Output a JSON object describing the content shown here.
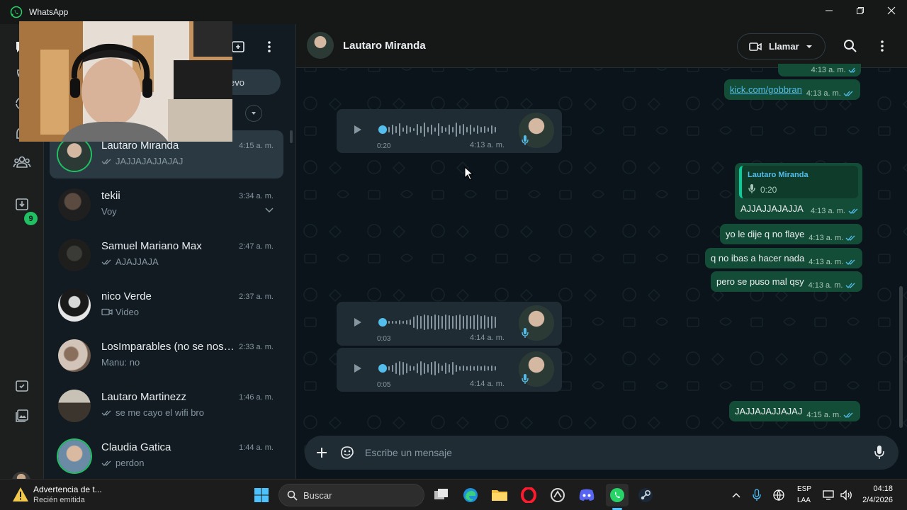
{
  "window": {
    "title": "WhatsApp"
  },
  "chat_list": {
    "new_button_fragment": "evo",
    "chats": [
      {
        "name": "Lautaro Miranda",
        "time": "4:15 a. m.",
        "preview": "JAJJAJAJJAJAJ",
        "ticks": true
      },
      {
        "name": "tekii",
        "time": "3:34 a. m.",
        "preview": "Voy",
        "ticks": false
      },
      {
        "name": "Samuel Mariano Max",
        "time": "2:47 a. m.",
        "preview": "AJAJJAJA",
        "ticks": true
      },
      {
        "name": "nico Verde",
        "time": "2:37 a. m.",
        "preview": "Video",
        "ticks": false
      },
      {
        "name": "LosImparables (no se nos ...",
        "time": "2:33 a. m.",
        "preview": "Manu: no",
        "ticks": false
      },
      {
        "name": "Lautaro Martinezz",
        "time": "1:46 a. m.",
        "preview": "se me cayo el wifi bro",
        "ticks": true
      },
      {
        "name": "Claudia Gatica",
        "time": "1:44 a. m.",
        "preview": "perdon",
        "ticks": true
      }
    ],
    "rail_badge": "9"
  },
  "conversation": {
    "contact_name": "Lautaro Miranda",
    "call_label": "Llamar",
    "messages": {
      "m0_time": "4:13 a. m.",
      "m1_link": "kick.com/gobbran",
      "m1_time": "4:13 a. m.",
      "v1_duration": "0:20",
      "v1_time": "4:13 a. m.",
      "reply_name": "Lautaro Miranda",
      "reply_duration": "0:20",
      "reply_text": "AJJAJJAJAJJA",
      "reply_time": "4:13 a. m.",
      "m3_text": "yo le dije q no flaye",
      "m3_time": "4:13 a. m.",
      "m4_text": "q no ibas a hacer nada",
      "m4_time": "4:13 a. m.",
      "m5_text": "pero se puso mal qsy",
      "m5_time": "4:13 a. m.",
      "v2_duration": "0:03",
      "v2_time": "4:14 a. m.",
      "v3_duration": "0:05",
      "v3_time": "4:14 a. m.",
      "m6_text": "JAJJAJAJJAJAJ",
      "m6_time": "4:15 a. m."
    },
    "composer_placeholder": "Escribe un mensaje"
  },
  "taskbar": {
    "notification_title": "Advertencia de t...",
    "notification_sub": "Recién emitida",
    "search_label": "Buscar",
    "lang_line1": "ESP",
    "lang_line2": "LAA",
    "clock": "04:18",
    "date": "2/4/2026"
  },
  "colors": {
    "accent_green": "#21c063",
    "outgoing_bubble": "#144d37",
    "incoming_bubble": "#202c33",
    "link_blue": "#53bdeb",
    "read_ticks": "#53bdeb"
  }
}
